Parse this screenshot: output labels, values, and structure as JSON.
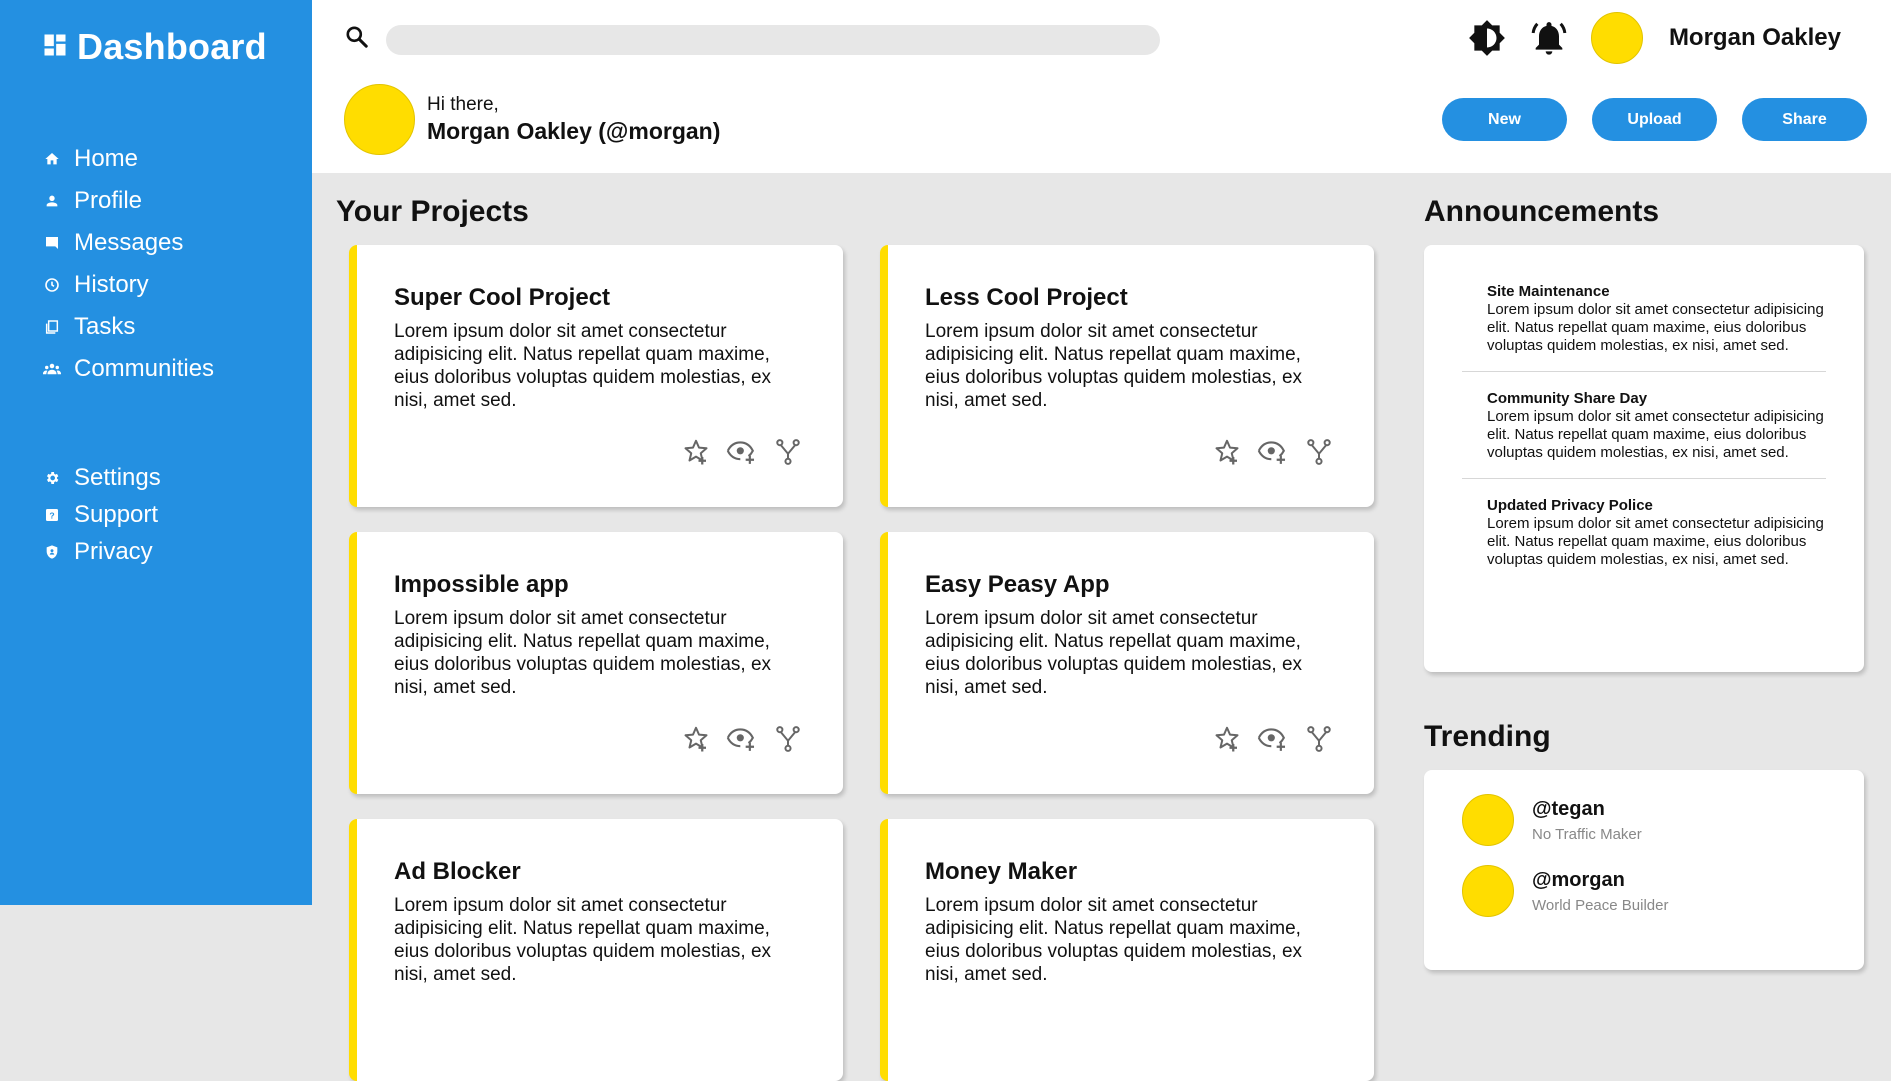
{
  "sidebar": {
    "title": "Dashboard",
    "logo_icon": "dashboard-icon",
    "items": [
      {
        "label": "Home",
        "icon": "home-icon"
      },
      {
        "label": "Profile",
        "icon": "profile-icon"
      },
      {
        "label": "Messages",
        "icon": "messages-icon"
      },
      {
        "label": "History",
        "icon": "history-icon"
      },
      {
        "label": "Tasks",
        "icon": "tasks-icon"
      },
      {
        "label": "Communities",
        "icon": "communities-icon"
      }
    ],
    "secondary_items": [
      {
        "label": "Settings",
        "icon": "gear-icon"
      },
      {
        "label": "Support",
        "icon": "help-icon"
      },
      {
        "label": "Privacy",
        "icon": "shield-icon"
      }
    ]
  },
  "header": {
    "search_placeholder": "",
    "user_name": "Morgan Oakley",
    "greeting": "Hi there,",
    "full_name": "Morgan Oakley (@morgan)",
    "buttons": {
      "new": "New",
      "upload": "Upload",
      "share": "Share"
    }
  },
  "projects": {
    "title": "Your Projects",
    "items": [
      {
        "title": "Super Cool Project",
        "description": "Lorem ipsum dolor sit amet consectetur adipisicing elit. Natus repellat quam maxime, eius doloribus voluptas quidem molestias, ex nisi, amet sed."
      },
      {
        "title": "Less Cool Project",
        "description": "Lorem ipsum dolor sit amet consectetur adipisicing elit. Natus repellat quam maxime, eius doloribus voluptas quidem molestias, ex nisi, amet sed."
      },
      {
        "title": "Impossible app",
        "description": "Lorem ipsum dolor sit amet consectetur adipisicing elit. Natus repellat quam maxime, eius doloribus voluptas quidem molestias, ex nisi, amet sed."
      },
      {
        "title": "Easy Peasy App",
        "description": "Lorem ipsum dolor sit amet consectetur adipisicing elit. Natus repellat quam maxime, eius doloribus voluptas quidem molestias, ex nisi, amet sed."
      },
      {
        "title": "Ad Blocker",
        "description": "Lorem ipsum dolor sit amet consectetur adipisicing elit. Natus repellat quam maxime, eius doloribus voluptas quidem molestias, ex nisi, amet sed."
      },
      {
        "title": "Money Maker",
        "description": "Lorem ipsum dolor sit amet consectetur adipisicing elit. Natus repellat quam maxime, eius doloribus voluptas quidem molestias, ex nisi, amet sed."
      }
    ]
  },
  "announcements": {
    "title": "Announcements",
    "items": [
      {
        "title": "Site Maintenance",
        "text": "Lorem ipsum dolor sit amet consectetur adipisicing elit. Natus repellat quam maxime, eius doloribus voluptas quidem molestias, ex nisi, amet sed."
      },
      {
        "title": "Community Share Day",
        "text": "Lorem ipsum dolor sit amet consectetur adipisicing elit. Natus repellat quam maxime, eius doloribus voluptas quidem molestias, ex nisi, amet sed."
      },
      {
        "title": "Updated Privacy Police",
        "text": "Lorem ipsum dolor sit amet consectetur adipisicing elit. Natus repellat quam maxime, eius doloribus voluptas quidem molestias, ex nisi, amet sed."
      }
    ]
  },
  "trending": {
    "title": "Trending",
    "items": [
      {
        "handle": "@tegan",
        "subtitle": "No Traffic Maker"
      },
      {
        "handle": "@morgan",
        "subtitle": "World Peace Builder"
      }
    ]
  },
  "colors": {
    "accent": "#2490e1",
    "avatar": "#ffdd00",
    "card_border": "#ffdd00",
    "background": "#e7e7e7"
  }
}
